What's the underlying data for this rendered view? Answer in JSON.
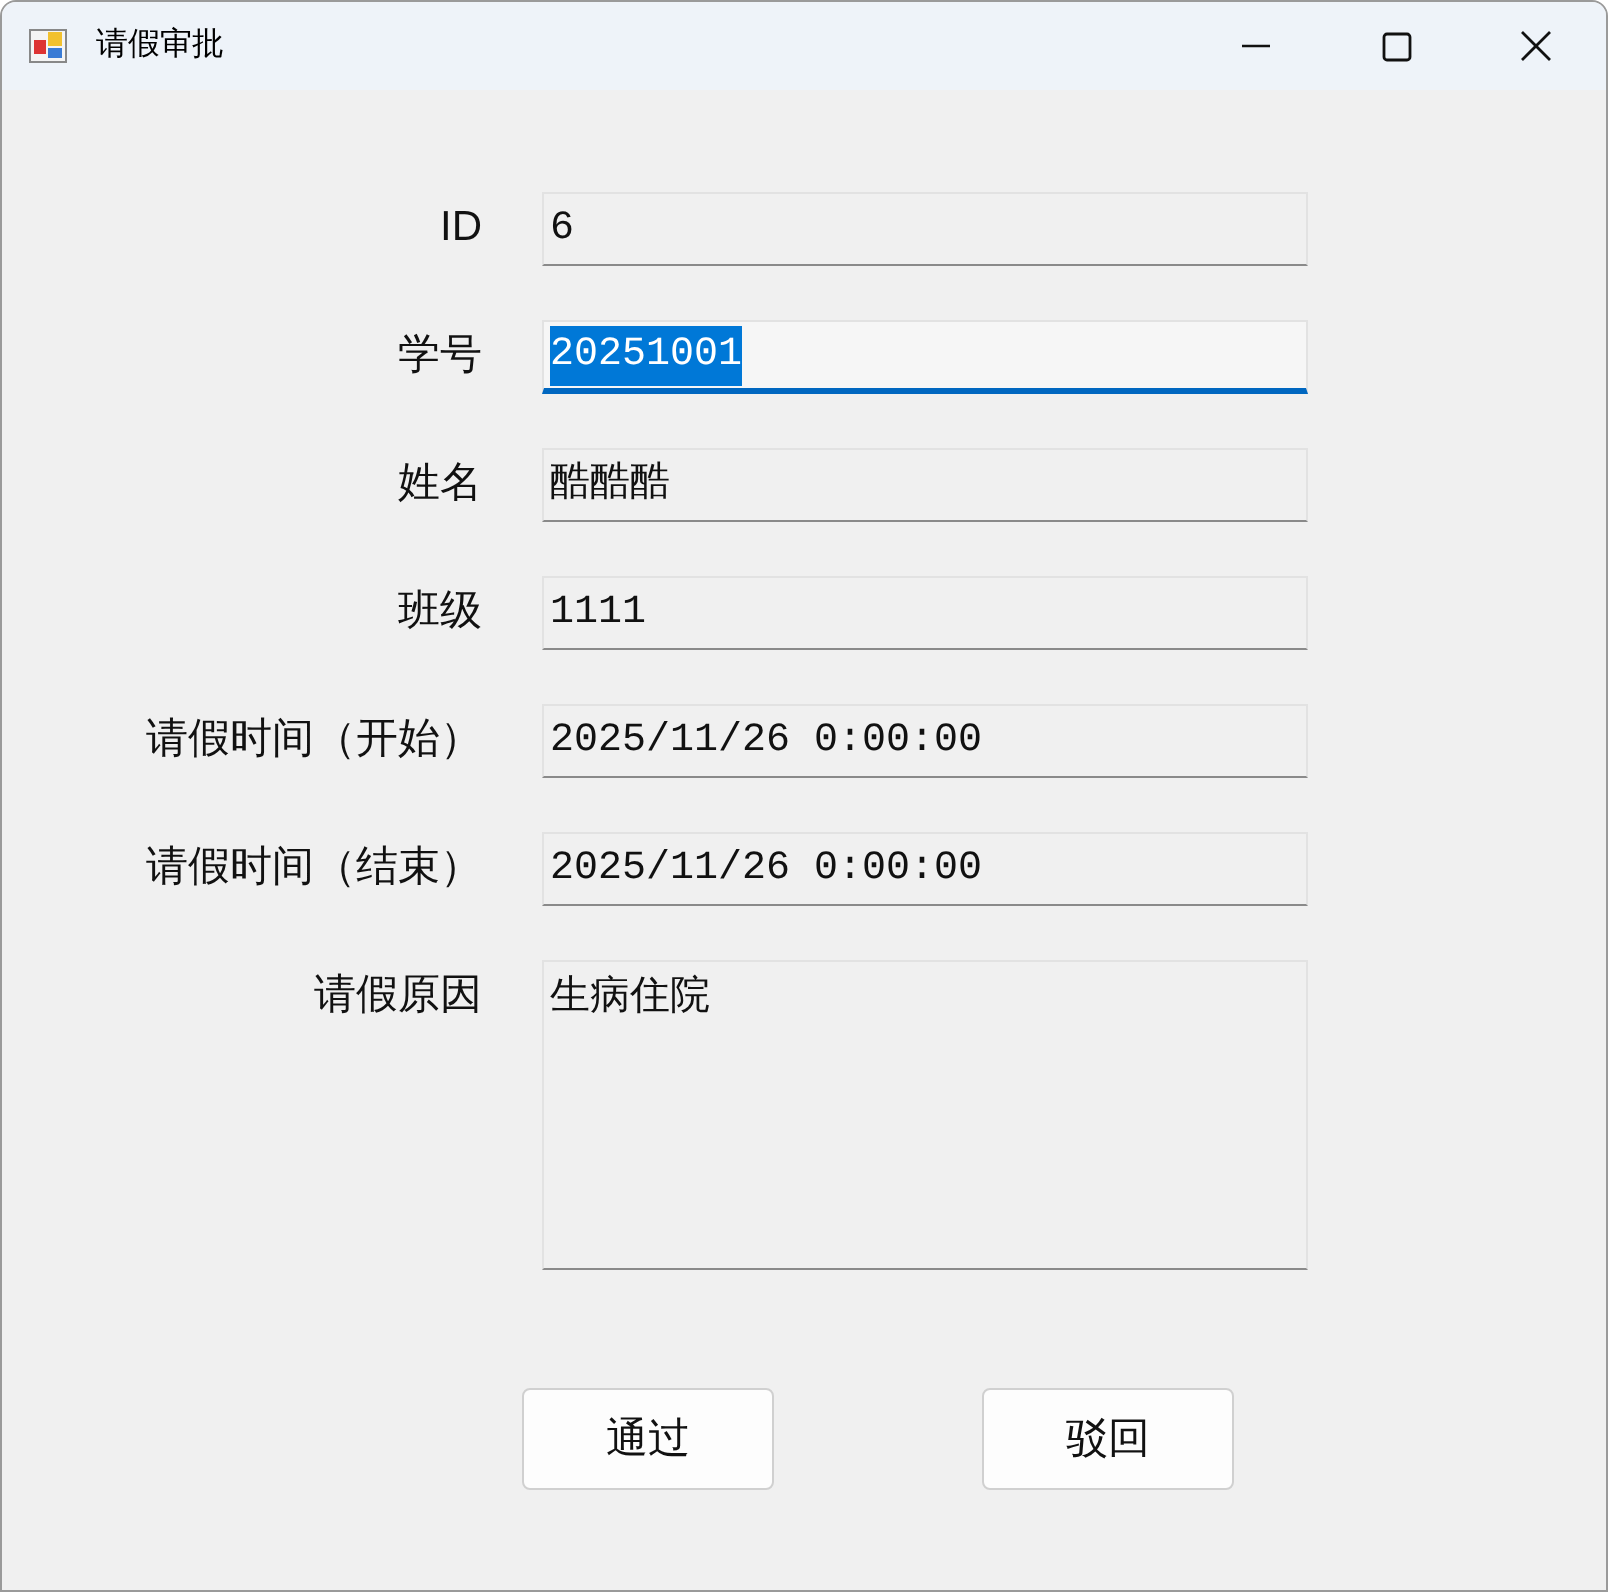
{
  "window": {
    "title": "请假审批"
  },
  "fields": [
    {
      "label": "ID",
      "value": "6",
      "kind": "line",
      "focused": false
    },
    {
      "label": "学号",
      "value": "20251001",
      "kind": "line",
      "focused": true
    },
    {
      "label": "姓名",
      "value": "酷酷酷",
      "kind": "line",
      "focused": false
    },
    {
      "label": "班级",
      "value": "1111",
      "kind": "line",
      "focused": false
    },
    {
      "label": "请假时间（开始）",
      "value": "2025/11/26 0:00:00",
      "kind": "line",
      "focused": false
    },
    {
      "label": "请假时间（结束）",
      "value": "2025/11/26 0:00:00",
      "kind": "line",
      "focused": false
    },
    {
      "label": "请假原因",
      "value": "生病住院",
      "kind": "multiline",
      "focused": false
    }
  ],
  "buttons": [
    "通过",
    "驳回"
  ]
}
